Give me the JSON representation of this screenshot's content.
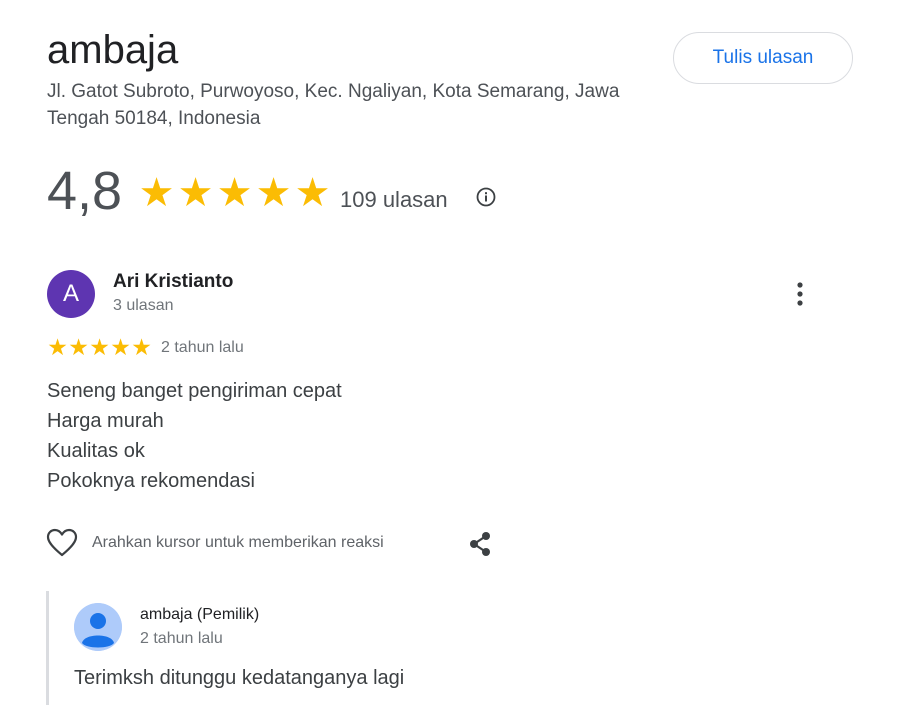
{
  "place": {
    "name": "ambaja",
    "address": "Jl. Gatot Subroto, Purwoyoso, Kec. Ngaliyan, Kota Semarang, Jawa Tengah 50184, Indonesia",
    "write_review_label": "Tulis ulasan"
  },
  "rating": {
    "value": "4,8",
    "stars": 5,
    "count_label": "109 ulasan",
    "info_icon": "info-icon"
  },
  "review": {
    "avatar_letter": "A",
    "avatar_color": "#5e35b1",
    "author": "Ari Kristianto",
    "author_reviews": "3 ulasan",
    "stars": 5,
    "date": "2 tahun lalu",
    "lines": [
      "Seneng banget pengiriman cepat",
      "Harga murah",
      "Kualitas ok",
      "Pokoknya rekomendasi"
    ],
    "reaction_hint": "Arahkan kursor untuk memberikan reaksi",
    "more_icon": "more-vert-icon",
    "like_icon": "heart-icon",
    "share_icon": "share-icon"
  },
  "owner_reply": {
    "name": "ambaja (Pemilik)",
    "date": "2 tahun lalu",
    "text": "Terimksh ditunggu kedatanganya lagi",
    "avatar_icon": "person-icon"
  },
  "colors": {
    "star": "#fbbc04",
    "link": "#1a73e8"
  }
}
